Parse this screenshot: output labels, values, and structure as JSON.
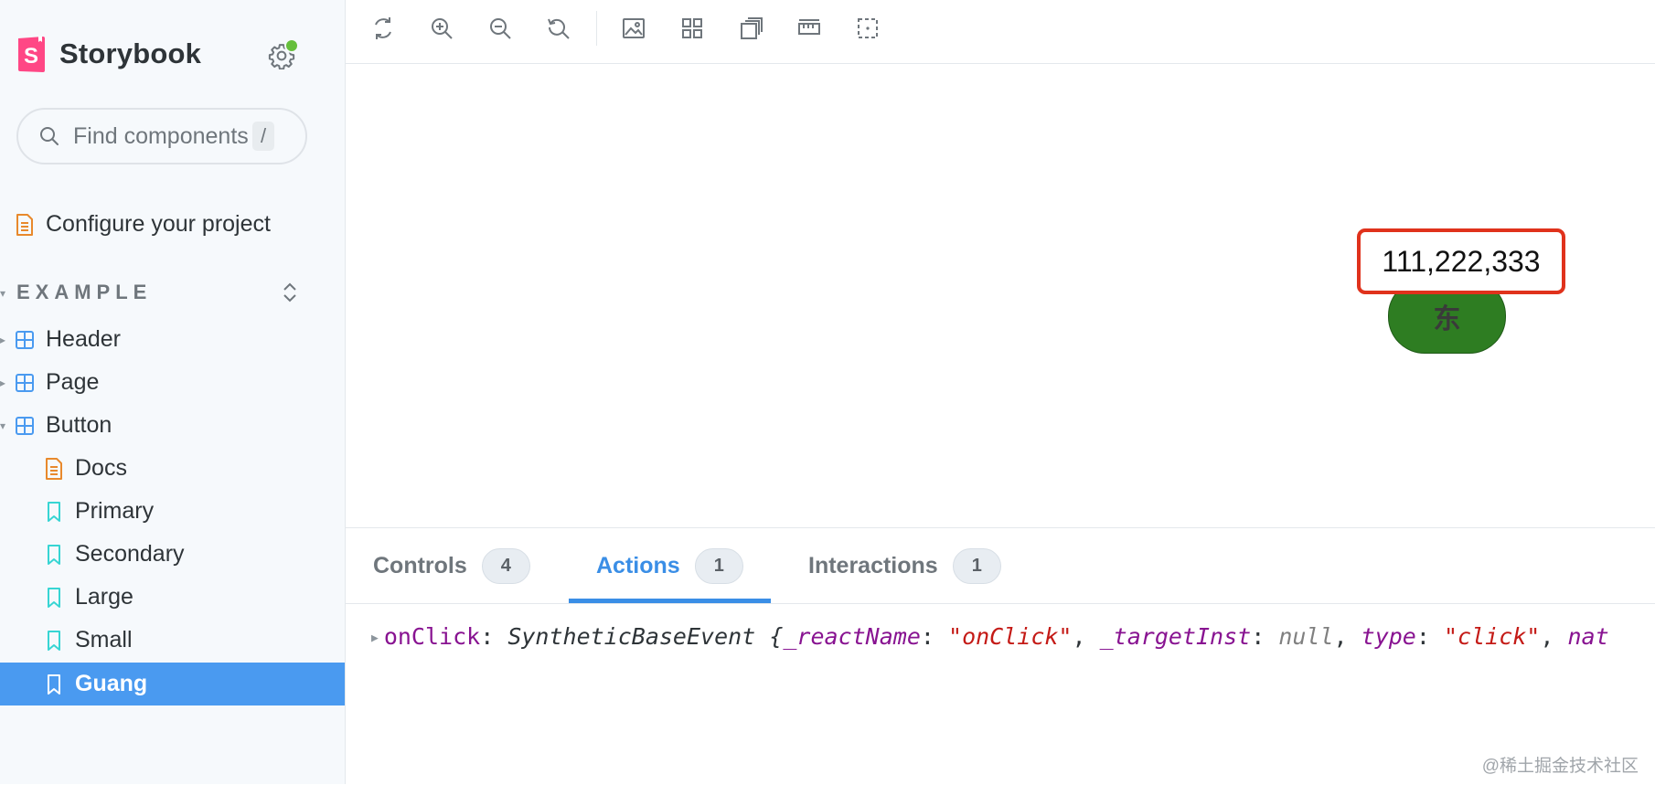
{
  "app": {
    "name": "Storybook"
  },
  "search": {
    "placeholder": "Find components",
    "shortcut": "/"
  },
  "sidebar": {
    "configure_label": "Configure your project",
    "section_title": "EXAMPLE",
    "items": [
      {
        "label": "Header",
        "icon": "component-icon"
      },
      {
        "label": "Page",
        "icon": "component-icon"
      },
      {
        "label": "Button",
        "icon": "component-icon"
      }
    ],
    "button_children": [
      {
        "label": "Docs",
        "icon": "docs-icon"
      },
      {
        "label": "Primary",
        "icon": "story-icon"
      },
      {
        "label": "Secondary",
        "icon": "story-icon"
      },
      {
        "label": "Large",
        "icon": "story-icon"
      },
      {
        "label": "Small",
        "icon": "story-icon"
      },
      {
        "label": "Guang",
        "icon": "story-icon",
        "selected": true
      }
    ]
  },
  "toolbar": {
    "tools": [
      "reload-icon",
      "zoom-in-icon",
      "zoom-out-icon",
      "reset-zoom-icon",
      "background-icon",
      "grid-icon",
      "viewport-icon",
      "measure-icon",
      "outline-icon"
    ]
  },
  "canvas": {
    "button_label": "东",
    "value_display": "111,222,333"
  },
  "panel": {
    "tabs": [
      {
        "label": "Controls",
        "count": "4"
      },
      {
        "label": "Actions",
        "count": "1",
        "active": true
      },
      {
        "label": "Interactions",
        "count": "1"
      }
    ],
    "log": {
      "event_name": "onClick",
      "colon": ":",
      "class_name": "SyntheticBaseEvent",
      "open_brace": "{",
      "key1": "_reactName",
      "val1": "\"onClick\"",
      "key2": "_targetInst",
      "val2": "null",
      "key3": "type",
      "val3": "\"click\"",
      "trailing": "nat"
    }
  },
  "watermark": "@稀土掘金技术社区",
  "colors": {
    "accent": "#4a9af0",
    "highlight_border": "#e0321c",
    "button_bg": "#2e7d22"
  }
}
